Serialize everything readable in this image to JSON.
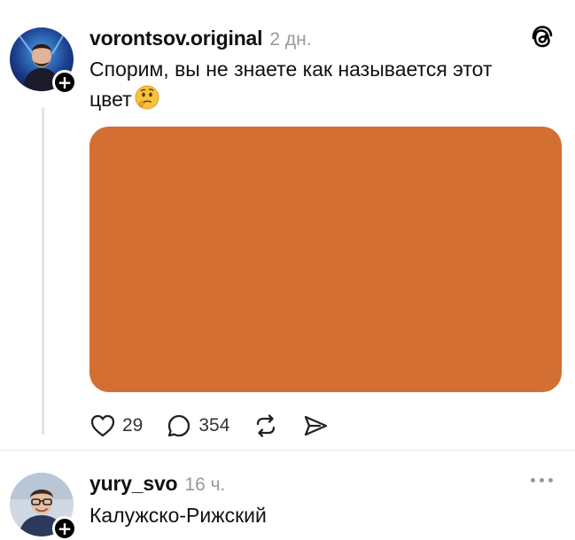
{
  "post": {
    "username": "vorontsov.original",
    "time": "2 дн.",
    "text_line1": "Спорим, вы не знаете как называется этот",
    "text_line2": "цвет",
    "emoji": "thinking-face",
    "swatch_color": "#D46F33",
    "likes": "29",
    "comments": "354"
  },
  "reply": {
    "username": "yury_svo",
    "time": "16 ч.",
    "text": "Калужско-Рижский"
  },
  "colors": {
    "text": "#111111",
    "muted": "#999999",
    "thread_line": "#E3E3E3"
  }
}
